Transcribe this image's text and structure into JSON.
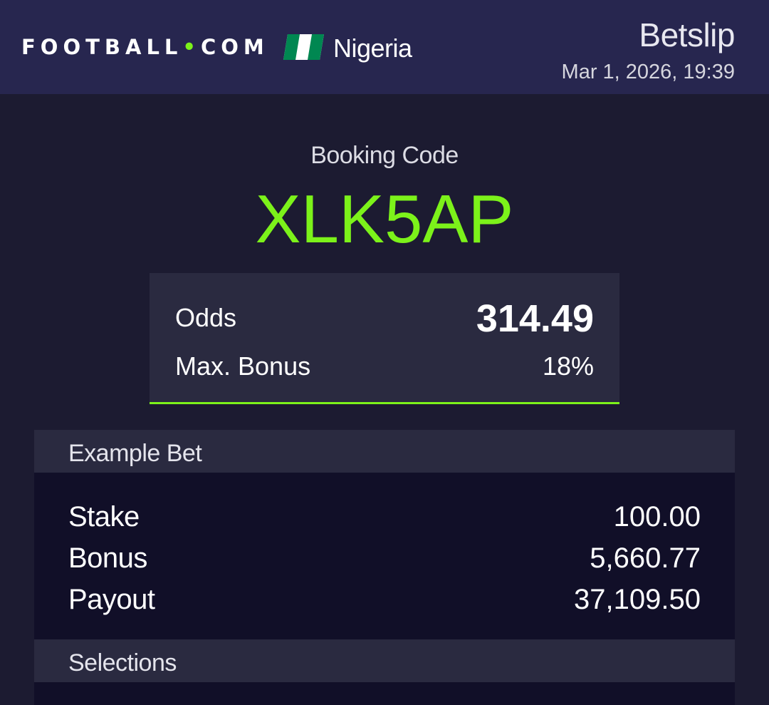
{
  "header": {
    "brand_main": "FOOTBALL",
    "brand_dot": "•",
    "brand_tld": "COM",
    "country": "Nigeria",
    "flag_icon": "nigeria-flag-icon",
    "title": "Betslip",
    "datetime": "Mar 1, 2026, 19:39"
  },
  "booking": {
    "label": "Booking Code",
    "code": "XLK5AP"
  },
  "summary": {
    "odds_label": "Odds",
    "odds_value": "314.49",
    "bonus_label": "Max. Bonus",
    "bonus_value": "18%"
  },
  "example_bet": {
    "title": "Example Bet",
    "rows": [
      {
        "label": "Stake",
        "value": "100.00"
      },
      {
        "label": "Bonus",
        "value": "5,660.77"
      },
      {
        "label": "Payout",
        "value": "37,109.50"
      }
    ]
  },
  "selections": {
    "title": "Selections"
  },
  "colors": {
    "accent": "#7cf21a",
    "header_bg": "#27264f",
    "page_bg": "#1c1b31",
    "panel_bg": "#2a2a40",
    "dark_bg": "#110f28",
    "flag_green": "#008751"
  }
}
